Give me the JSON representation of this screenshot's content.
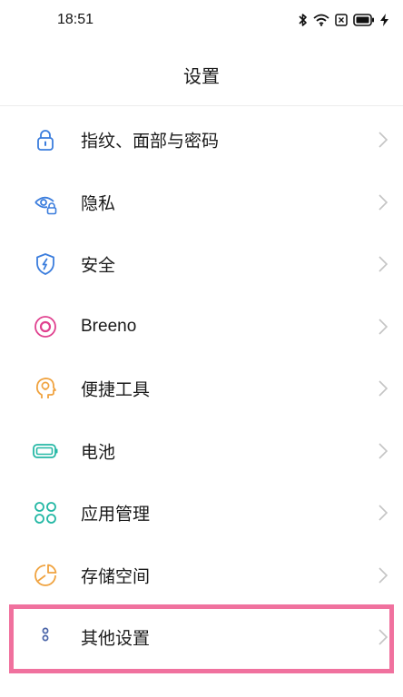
{
  "status_bar": {
    "time": "18:51",
    "icons": [
      "bluetooth-icon",
      "wifi-icon",
      "sim-icon",
      "battery-icon",
      "charging-icon"
    ]
  },
  "header": {
    "title": "设置"
  },
  "settings": [
    {
      "label": "指纹、面部与密码",
      "icon": "lock-icon",
      "color": "#3b7ddd"
    },
    {
      "label": "隐私",
      "icon": "privacy-eye-icon",
      "color": "#3b7ddd"
    },
    {
      "label": "安全",
      "icon": "shield-icon",
      "color": "#3b7ddd"
    },
    {
      "label": "Breeno",
      "icon": "breeno-icon",
      "color": "#e0418f"
    },
    {
      "label": "便捷工具",
      "icon": "head-bulb-icon",
      "color": "#f0a340"
    },
    {
      "label": "电池",
      "icon": "battery-icon",
      "color": "#25b8a5"
    },
    {
      "label": "应用管理",
      "icon": "apps-icon",
      "color": "#25b8a5"
    },
    {
      "label": "存储空间",
      "icon": "storage-pie-icon",
      "color": "#f0a340"
    },
    {
      "label": "其他设置",
      "icon": "more-dots-icon",
      "color": "#4a64a8"
    }
  ],
  "highlight_color": "#f0719e"
}
